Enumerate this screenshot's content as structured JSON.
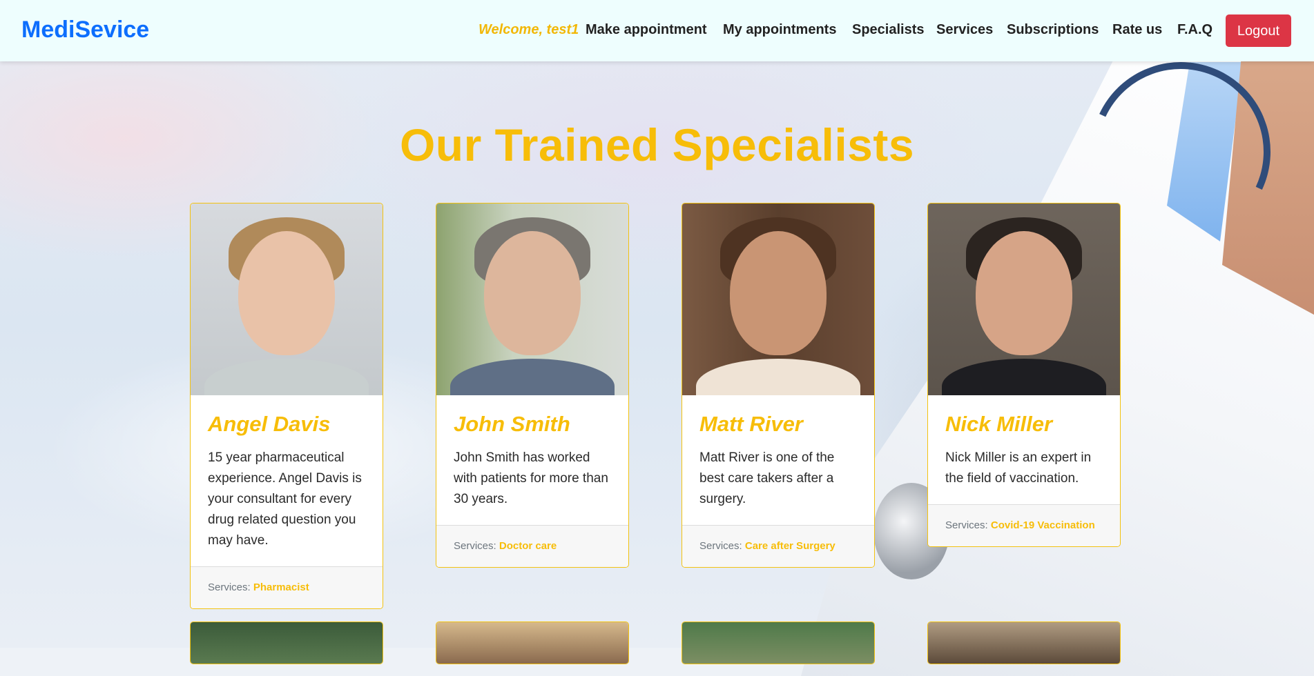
{
  "navbar": {
    "brand": "MediSevice",
    "welcome": "Welcome, test1",
    "links": [
      "Make appointment",
      "My appointments",
      "Specialists",
      "Services",
      "Subscriptions",
      "Rate us",
      "F.A.Q"
    ],
    "logout_label": "Logout"
  },
  "heading": "Our Trained Specialists",
  "services_label": "Services:",
  "specialists": [
    {
      "name": "Angel Davis",
      "description": "15 year pharmaceutical experience. Angel Davis is your consultant for every drug related question you may have.",
      "service": "Pharmacist"
    },
    {
      "name": "John Smith",
      "description": "John Smith has worked with patients for more than 30 years.",
      "service": "Doctor care"
    },
    {
      "name": "Matt River",
      "description": "Matt River is one of the best care takers after a surgery.",
      "service": "Care after Surgery"
    },
    {
      "name": "Nick Miller",
      "description": "Nick Miller is an expert in the field of vaccination.",
      "service": "Covid-19 Vaccination"
    }
  ],
  "colors": {
    "brand": "#0d6efd",
    "accent": "#f7bd09",
    "logout": "#dc3545",
    "navbar_bg": "#eefefe"
  }
}
